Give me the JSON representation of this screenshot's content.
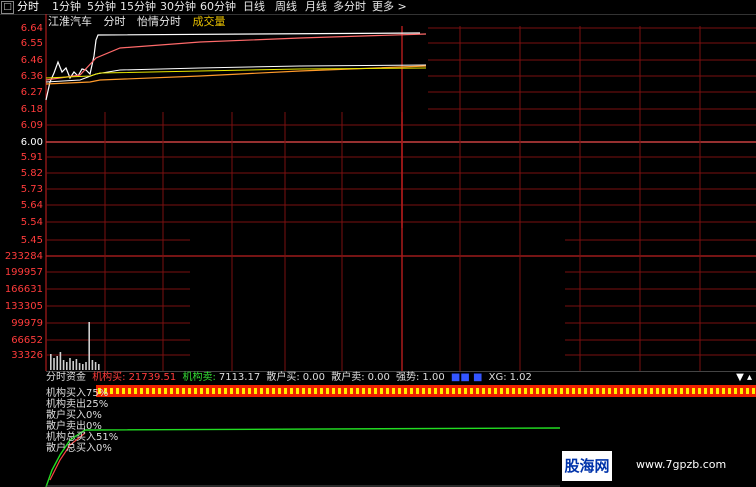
{
  "tabs": [
    {
      "label": "分时",
      "active": true
    },
    {
      "label": "1分钟"
    },
    {
      "label": "5分钟"
    },
    {
      "label": "15分钟"
    },
    {
      "label": "30分钟"
    },
    {
      "label": "60分钟"
    },
    {
      "label": "日线"
    },
    {
      "label": "周线"
    },
    {
      "label": "月线"
    },
    {
      "label": "多分时"
    },
    {
      "label": "更多 >"
    }
  ],
  "tab_lead": "□",
  "header": {
    "stock": "江淮汽车",
    "view": "分时",
    "indicator": "怡情分时",
    "volume": "成交量"
  },
  "price_axis": [
    "6.64",
    "6.55",
    "6.46",
    "6.36",
    "6.27",
    "6.18",
    "6.09",
    "6.00",
    "5.91",
    "5.82",
    "5.73",
    "5.64",
    "5.54",
    "5.45"
  ],
  "volume_axis": [
    "233284",
    "199957",
    "166631",
    "133305",
    "99979",
    "66652",
    "33326"
  ],
  "fund_bar": {
    "title": "分时资金",
    "inst_buy_label": "机构买:",
    "inst_buy": "21739.51",
    "inst_sell_label": "机构卖:",
    "inst_sell": "7113.17",
    "retail_buy_label": "散户买:",
    "retail_buy": "0.00",
    "retail_sell_label": "散户卖:",
    "retail_sell": "0.00",
    "strength_label": "强势:",
    "strength": "1.00",
    "xg_label": "XG:",
    "xg": "1.02",
    "collapse": "▼ ▴"
  },
  "lower_labels": [
    "机构买入75%",
    "机构卖出25%",
    "散户买入0%",
    "散户卖出0%",
    "机构总买入51%",
    "散户总买入0%"
  ],
  "watermark": {
    "logo": "股海网",
    "site": "www.7gpzb.com"
  },
  "colors": {
    "price_up": "#ff3b3b",
    "grid": "#7a1010",
    "line_white": "#ffffff",
    "line_yellow": "#e8e800",
    "line_pink": "#ff6a6a",
    "line_orange": "#ff9a2a",
    "volume_bar": "#cfcfcf",
    "heat_red": "#ee2200",
    "heat_yellow": "#ffee00",
    "green_line": "#22dd22"
  }
}
